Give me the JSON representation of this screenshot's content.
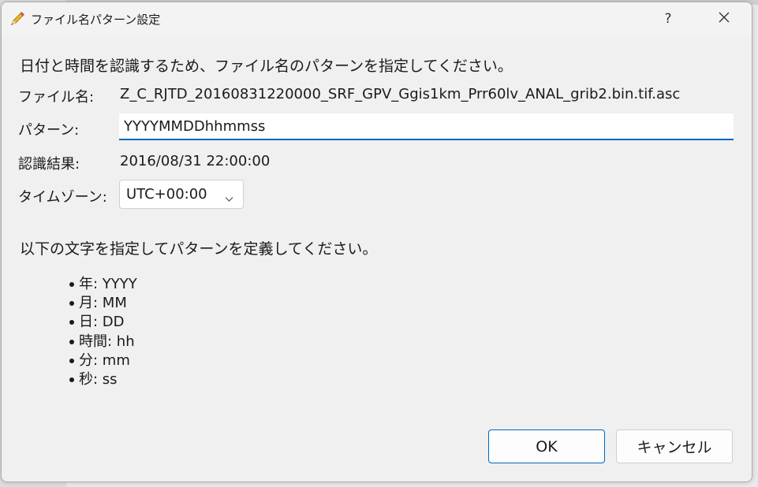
{
  "window": {
    "title": "ファイル名パターン設定",
    "help_label": "?",
    "icon": "pencil-icon"
  },
  "form": {
    "instruction": "日付と時間を認識するため、ファイル名のパターンを指定してください。",
    "filename_label": "ファイル名:",
    "filename_value": "Z_C_RJTD_20160831220000_SRF_GPV_Ggis1km_Prr60lv_ANAL_grib2.bin.tif.asc",
    "pattern_label": "パターン:",
    "pattern_value": "YYYYMMDDhhmmss",
    "result_label": "認識結果:",
    "result_value": "2016/08/31 22:00:00",
    "timezone_label": "タイムゾーン:",
    "timezone_value": "UTC+00:00"
  },
  "help": {
    "define_text": "以下の文字を指定してパターンを定義してください。",
    "rules": [
      "年: YYYY",
      "月: MM",
      "日: DD",
      "時間: hh",
      "分: mm",
      "秒: ss"
    ]
  },
  "buttons": {
    "ok": "OK",
    "cancel": "キャンセル"
  },
  "colors": {
    "accent": "#0067c0",
    "dialog_bg": "#f0f0f0"
  }
}
